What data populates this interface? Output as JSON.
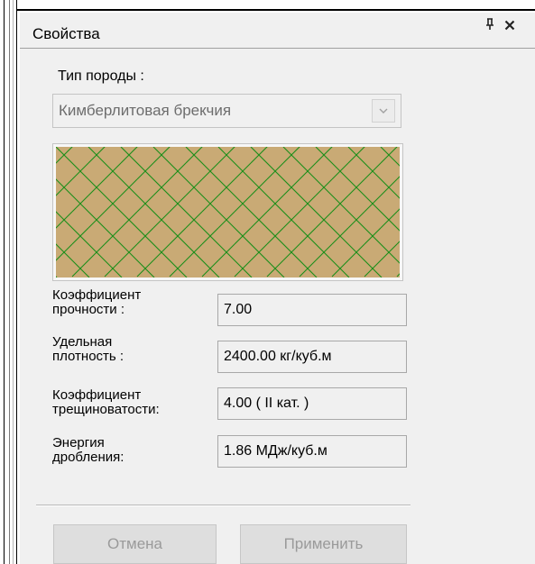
{
  "panel": {
    "title": "Свойства",
    "pin_glyph": "ᵽ",
    "close_glyph": "✕"
  },
  "rock_type": {
    "label": "Тип породы :",
    "selected": "Кимберлитовая брекчия"
  },
  "pattern": {
    "name": "herringbone",
    "fill_color": "#c9aa75",
    "line_color": "#1a8f1a"
  },
  "properties": [
    {
      "label_line1": "Коэффициент",
      "label_line2": "прочности :",
      "value": "7.00"
    },
    {
      "label_line1": "Удельная",
      "label_line2": "плотность :",
      "value": "2400.00 кг/куб.м"
    },
    {
      "label_line1": "Коэффициент",
      "label_line2": "трещиноватости:",
      "value": "4.00 ( II кат. )"
    },
    {
      "label_line1": "Энергия",
      "label_line2": "дробления:",
      "value": "1.86 МДж/куб.м"
    }
  ],
  "buttons": {
    "cancel": "Отмена",
    "apply": "Применить"
  },
  "icons": {
    "pin": "pin-icon",
    "close": "close-icon",
    "dropdown": "chevron-down-icon"
  }
}
